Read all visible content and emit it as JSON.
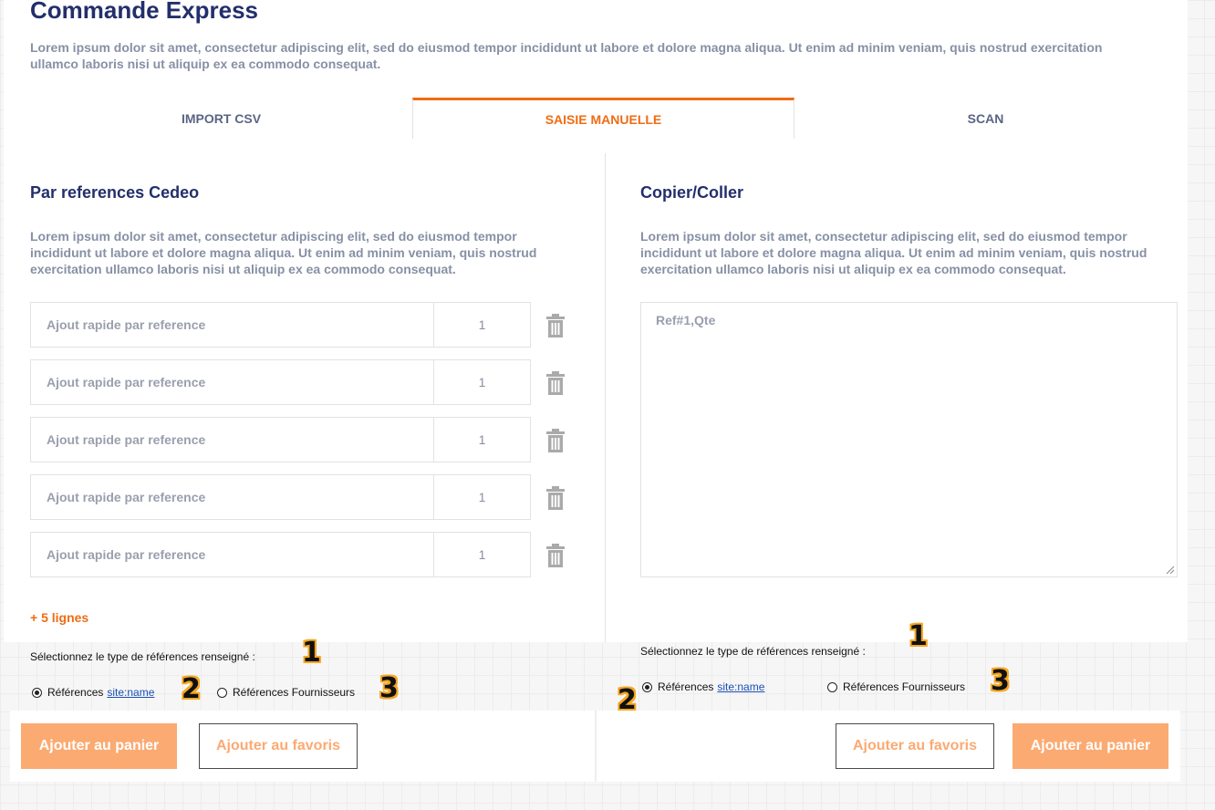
{
  "header": {
    "title": "Commande Express",
    "intro": "Lorem ipsum dolor sit amet, consectetur adipiscing elit, sed do eiusmod tempor incididunt ut labore et dolore magna aliqua. Ut enim ad minim veniam, quis nostrud exercitation ullamco laboris nisi ut aliquip ex ea commodo consequat."
  },
  "tabs": [
    {
      "label": "IMPORT CSV",
      "active": false
    },
    {
      "label": "SAISIE MANUELLE",
      "active": true
    },
    {
      "label": "SCAN",
      "active": false
    }
  ],
  "left": {
    "title": "Par references Cedeo",
    "description": "Lorem ipsum dolor sit amet, consectetur adipiscing elit, sed do eiusmod tempor incididunt ut labore et dolore magna aliqua. Ut enim ad minim veniam, quis nostrud exercitation ullamco laboris nisi ut aliquip ex ea commodo consequat.",
    "rows": [
      {
        "placeholder": "Ajout rapide par reference",
        "qty": "1"
      },
      {
        "placeholder": "Ajout rapide par reference",
        "qty": "1"
      },
      {
        "placeholder": "Ajout rapide par reference",
        "qty": "1"
      },
      {
        "placeholder": "Ajout rapide par reference",
        "qty": "1"
      },
      {
        "placeholder": "Ajout rapide par reference",
        "qty": "1"
      }
    ],
    "add_lines": "+ 5 lignes",
    "select_label": "Sélectionnez le type de références renseigné :",
    "radio_site_text": "Références",
    "radio_site_link": "site:name",
    "radio_supplier": "Références Fournisseurs",
    "badges": [
      "1",
      "2",
      "3"
    ],
    "btn_cart": "Ajouter au panier",
    "btn_fav": "Ajouter au favoris"
  },
  "right": {
    "title": "Copier/Coller",
    "description": "Lorem ipsum dolor sit amet, consectetur adipiscing elit, sed do eiusmod tempor incididunt ut labore et dolore magna aliqua. Ut enim ad minim veniam, quis nostrud exercitation ullamco laboris nisi ut aliquip ex ea commodo consequat.",
    "textarea_placeholder": "Ref#1,Qte",
    "select_label": "Sélectionnez le type de références renseigné :",
    "radio_site_text": "Références",
    "radio_site_link": "site:name",
    "radio_supplier": "Références Fournisseurs",
    "badges": [
      "1",
      "2",
      "3"
    ],
    "btn_fav": "Ajouter au favoris",
    "btn_cart": "Ajouter au panier"
  },
  "colors": {
    "accent": "#ef6c13",
    "title": "#232f6b",
    "button_primary": "#fbaa72"
  }
}
